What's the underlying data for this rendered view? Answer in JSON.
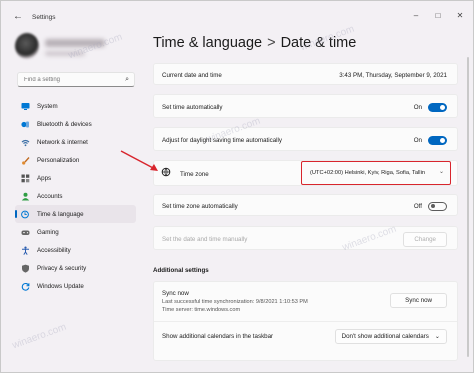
{
  "window": {
    "app_title": "Settings",
    "controls": [
      "–",
      "□",
      "✕"
    ]
  },
  "search": {
    "placeholder": "Find a setting"
  },
  "sidebar": {
    "items": [
      {
        "label": "System",
        "icon": "monitor-icon",
        "color": "#0078d4"
      },
      {
        "label": "Bluetooth & devices",
        "icon": "bluetooth-icon",
        "color": "#0078d4"
      },
      {
        "label": "Network & internet",
        "icon": "wifi-icon",
        "color": "#3a6ea5"
      },
      {
        "label": "Personalization",
        "icon": "brush-icon",
        "color": "#c06a20"
      },
      {
        "label": "Apps",
        "icon": "apps-icon",
        "color": "#555555"
      },
      {
        "label": "Accounts",
        "icon": "person-icon",
        "color": "#2f9e44"
      },
      {
        "label": "Time & language",
        "icon": "globe-clock-icon",
        "color": "#0078d4"
      },
      {
        "label": "Gaming",
        "icon": "gamepad-icon",
        "color": "#666666"
      },
      {
        "label": "Accessibility",
        "icon": "accessibility-icon",
        "color": "#2a5db0"
      },
      {
        "label": "Privacy & security",
        "icon": "shield-icon",
        "color": "#555555"
      },
      {
        "label": "Windows Update",
        "icon": "update-icon",
        "color": "#0078d4"
      }
    ],
    "active_index": 6
  },
  "header": {
    "section": "Time & language",
    "separator": ">",
    "page": "Date & time"
  },
  "settings": {
    "current_date_label": "Current date and time",
    "current_date_value": "3:43 PM, Thursday, September 9, 2021",
    "set_time_auto_label": "Set time automatically",
    "set_time_auto_state": "On",
    "dst_label": "Adjust for daylight saving time automatically",
    "dst_state": "On",
    "timezone_label": "Time zone",
    "timezone_value": "(UTC+02:00) Helsinki, Kyiv, Riga, Sofia, Tallin",
    "set_tz_auto_label": "Set time zone automatically",
    "set_tz_auto_state": "Off",
    "manual_label": "Set the date and time manually",
    "manual_button": "Change"
  },
  "additional": {
    "title": "Additional settings",
    "sync_label": "Sync now",
    "sync_last": "Last successful time synchronization: 9/8/2021 1:10:53 PM",
    "sync_server": "Time server: time.windows.com",
    "sync_button": "Sync now",
    "calendars_label": "Show additional calendars in the taskbar",
    "calendars_value": "Don't show additional calendars"
  },
  "watermark": "winaero.com",
  "colors": {
    "accent": "#0067c0",
    "highlight_box": "#d8252d",
    "arrow": "#d8252d"
  }
}
